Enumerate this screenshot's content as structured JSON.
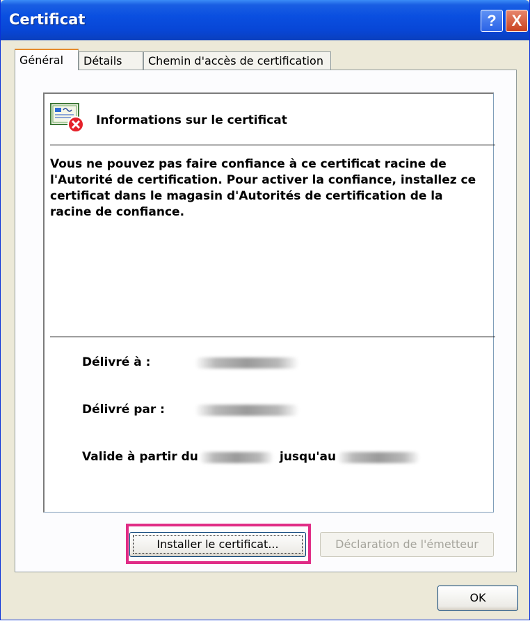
{
  "window": {
    "title": "Certificat",
    "help_glyph": "?",
    "close_glyph": "X"
  },
  "tabs": [
    {
      "label": "Général",
      "active": true
    },
    {
      "label": "Détails",
      "active": false
    },
    {
      "label": "Chemin d'accès de certification",
      "active": false
    }
  ],
  "certificate": {
    "icon": "certificate-error-icon",
    "heading": "Informations sur le certificat",
    "warning": "Vous ne pouvez pas faire confiance à ce certificat racine de l'Autorité de certification. Pour activer la confiance, installez ce certificat dans le magasin d'Autorités de certification de la racine de confiance.",
    "issued_to_label": "Délivré à :",
    "issued_by_label": "Délivré par :",
    "valid_from_label": "Valide à partir du",
    "valid_to_label": "jusqu'au"
  },
  "buttons": {
    "install_label": "Installer le certificat...",
    "declaration_label": "Déclaration de l'émetteur",
    "ok_label": "OK"
  },
  "colors": {
    "highlight": "#e02c86",
    "titlebar": "#0a4fe0"
  }
}
